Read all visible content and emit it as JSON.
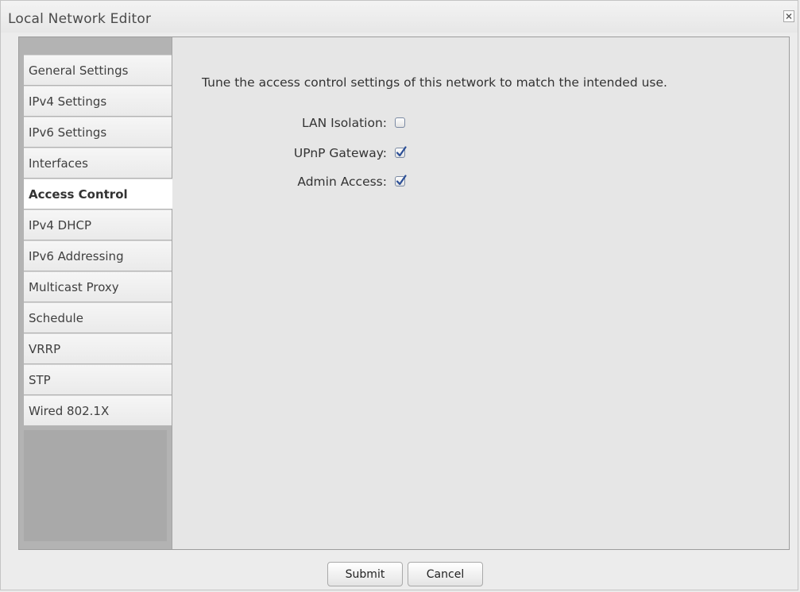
{
  "window": {
    "title": "Local Network Editor",
    "close_glyph": "×"
  },
  "sidebar": {
    "items": [
      {
        "label": "General Settings",
        "active": false
      },
      {
        "label": "IPv4 Settings",
        "active": false
      },
      {
        "label": "IPv6 Settings",
        "active": false
      },
      {
        "label": "Interfaces",
        "active": false
      },
      {
        "label": "Access Control",
        "active": true
      },
      {
        "label": "IPv4 DHCP",
        "active": false
      },
      {
        "label": "IPv6 Addressing",
        "active": false
      },
      {
        "label": "Multicast Proxy",
        "active": false
      },
      {
        "label": "Schedule",
        "active": false
      },
      {
        "label": "VRRP",
        "active": false
      },
      {
        "label": "STP",
        "active": false
      },
      {
        "label": "Wired 802.1X",
        "active": false
      }
    ]
  },
  "main": {
    "intro": "Tune the access control settings of this network to match the intended use.",
    "fields": [
      {
        "label": "LAN Isolation:",
        "checked": false
      },
      {
        "label": "UPnP Gateway:",
        "checked": true
      },
      {
        "label": "Admin Access:",
        "checked": true
      }
    ]
  },
  "footer": {
    "submit_label": "Submit",
    "cancel_label": "Cancel"
  },
  "colors": {
    "checkmark": "#2c4f96",
    "checkbox_border": "#7b8aa3"
  }
}
